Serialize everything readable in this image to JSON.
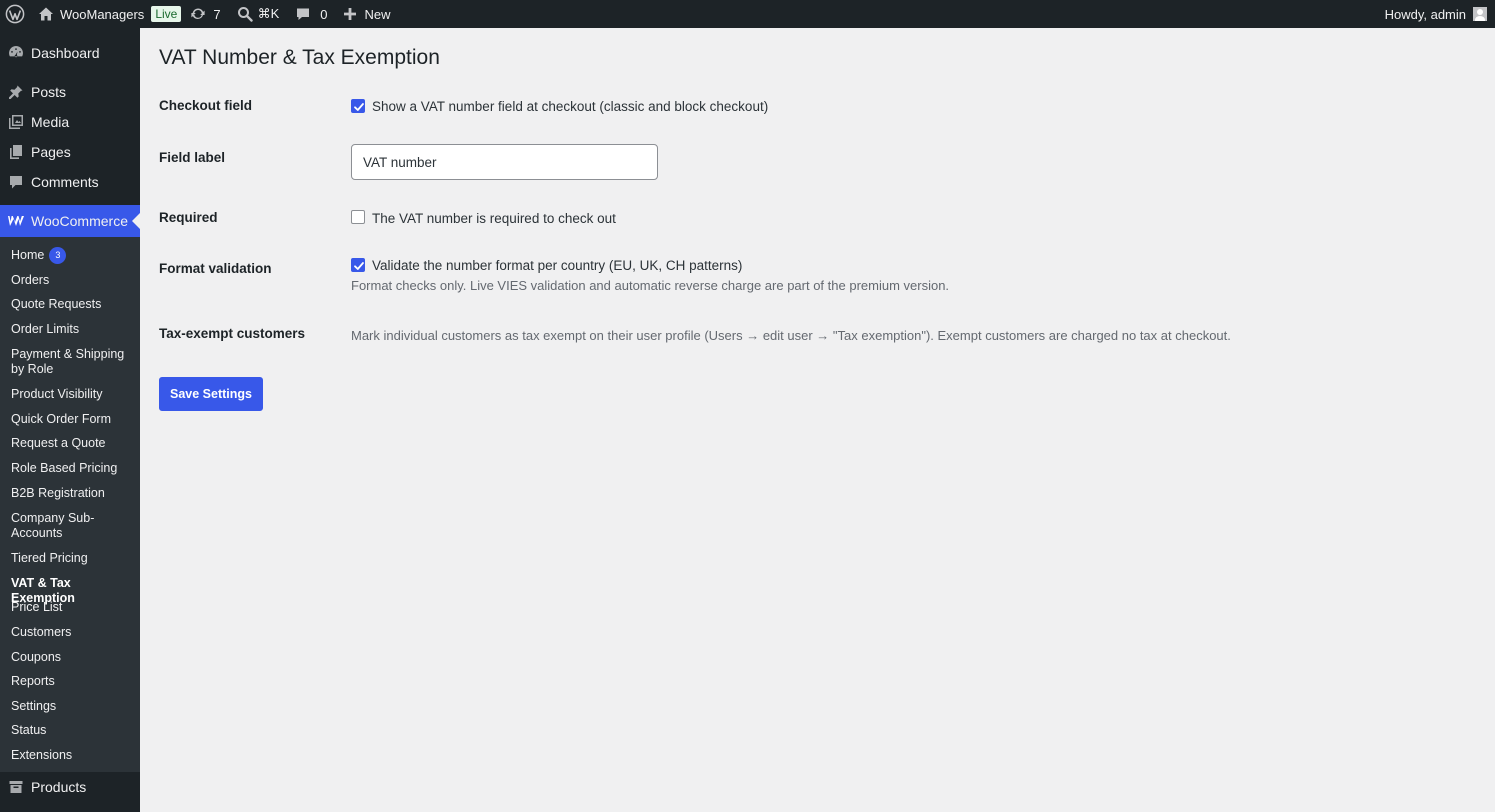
{
  "adminbar": {
    "site_name": "WooManagers",
    "live_badge": "Live",
    "updates_count": "7",
    "search_shortcut": "⌘K",
    "comments_count": "0",
    "new_label": "New",
    "greeting": "Howdy, admin"
  },
  "sidebar": {
    "dashboard": "Dashboard",
    "posts": "Posts",
    "media": "Media",
    "pages": "Pages",
    "comments": "Comments",
    "woocommerce": "WooCommerce",
    "products": "Products",
    "submenu": {
      "home": "Home",
      "home_badge": "3",
      "orders": "Orders",
      "quote_requests": "Quote Requests",
      "order_limits": "Order Limits",
      "payment_shipping_line1": "Payment & Shipping",
      "payment_shipping_line2": "by Role",
      "product_visibility": "Product Visibility",
      "quick_order_form": "Quick Order Form",
      "request_a_quote": "Request a Quote",
      "role_based_pricing": "Role Based Pricing",
      "b2b_registration": "B2B Registration",
      "company_sub_line1": "Company Sub-",
      "company_sub_line2": "Accounts",
      "tiered_pricing": "Tiered Pricing",
      "vat_tax_exemption": "VAT & Tax Exemption",
      "price_list": "Price List",
      "customers": "Customers",
      "coupons": "Coupons",
      "reports": "Reports",
      "settings": "Settings",
      "status": "Status",
      "extensions": "Extensions"
    }
  },
  "page": {
    "title": "VAT Number & Tax Exemption",
    "checkout_field": {
      "label": "Checkout field",
      "option": "Show a VAT number field at checkout (classic and block checkout)",
      "checked": true
    },
    "field_label": {
      "label": "Field label",
      "value": "VAT number"
    },
    "required": {
      "label": "Required",
      "option": "The VAT number is required to check out",
      "checked": false
    },
    "format_validation": {
      "label": "Format validation",
      "option": "Validate the number format per country (EU, UK, CH patterns)",
      "checked": true,
      "description": "Format checks only. Live VIES validation and automatic reverse charge are part of the premium version."
    },
    "tax_exempt": {
      "label": "Tax-exempt customers",
      "description": "Mark individual customers as tax exempt on their user profile (Users → edit user → \"Tax exemption\"). Exempt customers are charged no tax at checkout."
    },
    "save_label": "Save Settings"
  },
  "colors": {
    "accent": "#3858e9",
    "adminbar_bg": "#1d2327",
    "submenu_bg": "#2c3338",
    "page_bg": "#f0f0f1"
  }
}
